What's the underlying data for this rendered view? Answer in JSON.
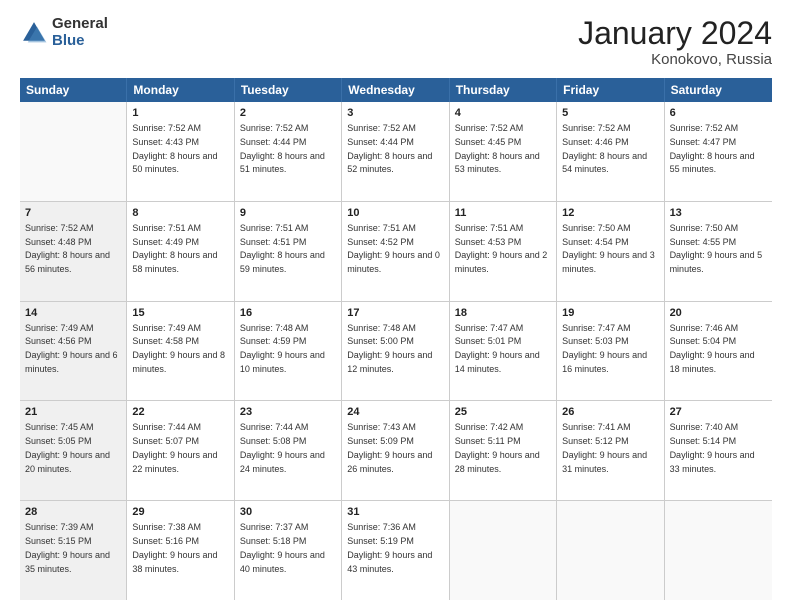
{
  "logo": {
    "general": "General",
    "blue": "Blue"
  },
  "title": "January 2024",
  "location": "Konokovo, Russia",
  "header_days": [
    "Sunday",
    "Monday",
    "Tuesday",
    "Wednesday",
    "Thursday",
    "Friday",
    "Saturday"
  ],
  "weeks": [
    [
      {
        "day": "",
        "sunrise": "",
        "sunset": "",
        "daylight": "",
        "empty": true
      },
      {
        "day": "1",
        "sunrise": "Sunrise: 7:52 AM",
        "sunset": "Sunset: 4:43 PM",
        "daylight": "Daylight: 8 hours and 50 minutes."
      },
      {
        "day": "2",
        "sunrise": "Sunrise: 7:52 AM",
        "sunset": "Sunset: 4:44 PM",
        "daylight": "Daylight: 8 hours and 51 minutes."
      },
      {
        "day": "3",
        "sunrise": "Sunrise: 7:52 AM",
        "sunset": "Sunset: 4:44 PM",
        "daylight": "Daylight: 8 hours and 52 minutes."
      },
      {
        "day": "4",
        "sunrise": "Sunrise: 7:52 AM",
        "sunset": "Sunset: 4:45 PM",
        "daylight": "Daylight: 8 hours and 53 minutes."
      },
      {
        "day": "5",
        "sunrise": "Sunrise: 7:52 AM",
        "sunset": "Sunset: 4:46 PM",
        "daylight": "Daylight: 8 hours and 54 minutes."
      },
      {
        "day": "6",
        "sunrise": "Sunrise: 7:52 AM",
        "sunset": "Sunset: 4:47 PM",
        "daylight": "Daylight: 8 hours and 55 minutes."
      }
    ],
    [
      {
        "day": "7",
        "sunrise": "Sunrise: 7:52 AM",
        "sunset": "Sunset: 4:48 PM",
        "daylight": "Daylight: 8 hours and 56 minutes.",
        "shaded": true
      },
      {
        "day": "8",
        "sunrise": "Sunrise: 7:51 AM",
        "sunset": "Sunset: 4:49 PM",
        "daylight": "Daylight: 8 hours and 58 minutes."
      },
      {
        "day": "9",
        "sunrise": "Sunrise: 7:51 AM",
        "sunset": "Sunset: 4:51 PM",
        "daylight": "Daylight: 8 hours and 59 minutes."
      },
      {
        "day": "10",
        "sunrise": "Sunrise: 7:51 AM",
        "sunset": "Sunset: 4:52 PM",
        "daylight": "Daylight: 9 hours and 0 minutes."
      },
      {
        "day": "11",
        "sunrise": "Sunrise: 7:51 AM",
        "sunset": "Sunset: 4:53 PM",
        "daylight": "Daylight: 9 hours and 2 minutes."
      },
      {
        "day": "12",
        "sunrise": "Sunrise: 7:50 AM",
        "sunset": "Sunset: 4:54 PM",
        "daylight": "Daylight: 9 hours and 3 minutes."
      },
      {
        "day": "13",
        "sunrise": "Sunrise: 7:50 AM",
        "sunset": "Sunset: 4:55 PM",
        "daylight": "Daylight: 9 hours and 5 minutes."
      }
    ],
    [
      {
        "day": "14",
        "sunrise": "Sunrise: 7:49 AM",
        "sunset": "Sunset: 4:56 PM",
        "daylight": "Daylight: 9 hours and 6 minutes.",
        "shaded": true
      },
      {
        "day": "15",
        "sunrise": "Sunrise: 7:49 AM",
        "sunset": "Sunset: 4:58 PM",
        "daylight": "Daylight: 9 hours and 8 minutes."
      },
      {
        "day": "16",
        "sunrise": "Sunrise: 7:48 AM",
        "sunset": "Sunset: 4:59 PM",
        "daylight": "Daylight: 9 hours and 10 minutes."
      },
      {
        "day": "17",
        "sunrise": "Sunrise: 7:48 AM",
        "sunset": "Sunset: 5:00 PM",
        "daylight": "Daylight: 9 hours and 12 minutes."
      },
      {
        "day": "18",
        "sunrise": "Sunrise: 7:47 AM",
        "sunset": "Sunset: 5:01 PM",
        "daylight": "Daylight: 9 hours and 14 minutes."
      },
      {
        "day": "19",
        "sunrise": "Sunrise: 7:47 AM",
        "sunset": "Sunset: 5:03 PM",
        "daylight": "Daylight: 9 hours and 16 minutes."
      },
      {
        "day": "20",
        "sunrise": "Sunrise: 7:46 AM",
        "sunset": "Sunset: 5:04 PM",
        "daylight": "Daylight: 9 hours and 18 minutes."
      }
    ],
    [
      {
        "day": "21",
        "sunrise": "Sunrise: 7:45 AM",
        "sunset": "Sunset: 5:05 PM",
        "daylight": "Daylight: 9 hours and 20 minutes.",
        "shaded": true
      },
      {
        "day": "22",
        "sunrise": "Sunrise: 7:44 AM",
        "sunset": "Sunset: 5:07 PM",
        "daylight": "Daylight: 9 hours and 22 minutes."
      },
      {
        "day": "23",
        "sunrise": "Sunrise: 7:44 AM",
        "sunset": "Sunset: 5:08 PM",
        "daylight": "Daylight: 9 hours and 24 minutes."
      },
      {
        "day": "24",
        "sunrise": "Sunrise: 7:43 AM",
        "sunset": "Sunset: 5:09 PM",
        "daylight": "Daylight: 9 hours and 26 minutes."
      },
      {
        "day": "25",
        "sunrise": "Sunrise: 7:42 AM",
        "sunset": "Sunset: 5:11 PM",
        "daylight": "Daylight: 9 hours and 28 minutes."
      },
      {
        "day": "26",
        "sunrise": "Sunrise: 7:41 AM",
        "sunset": "Sunset: 5:12 PM",
        "daylight": "Daylight: 9 hours and 31 minutes."
      },
      {
        "day": "27",
        "sunrise": "Sunrise: 7:40 AM",
        "sunset": "Sunset: 5:14 PM",
        "daylight": "Daylight: 9 hours and 33 minutes."
      }
    ],
    [
      {
        "day": "28",
        "sunrise": "Sunrise: 7:39 AM",
        "sunset": "Sunset: 5:15 PM",
        "daylight": "Daylight: 9 hours and 35 minutes.",
        "shaded": true
      },
      {
        "day": "29",
        "sunrise": "Sunrise: 7:38 AM",
        "sunset": "Sunset: 5:16 PM",
        "daylight": "Daylight: 9 hours and 38 minutes."
      },
      {
        "day": "30",
        "sunrise": "Sunrise: 7:37 AM",
        "sunset": "Sunset: 5:18 PM",
        "daylight": "Daylight: 9 hours and 40 minutes."
      },
      {
        "day": "31",
        "sunrise": "Sunrise: 7:36 AM",
        "sunset": "Sunset: 5:19 PM",
        "daylight": "Daylight: 9 hours and 43 minutes."
      },
      {
        "day": "",
        "sunrise": "",
        "sunset": "",
        "daylight": "",
        "empty": true
      },
      {
        "day": "",
        "sunrise": "",
        "sunset": "",
        "daylight": "",
        "empty": true
      },
      {
        "day": "",
        "sunrise": "",
        "sunset": "",
        "daylight": "",
        "empty": true
      }
    ]
  ]
}
